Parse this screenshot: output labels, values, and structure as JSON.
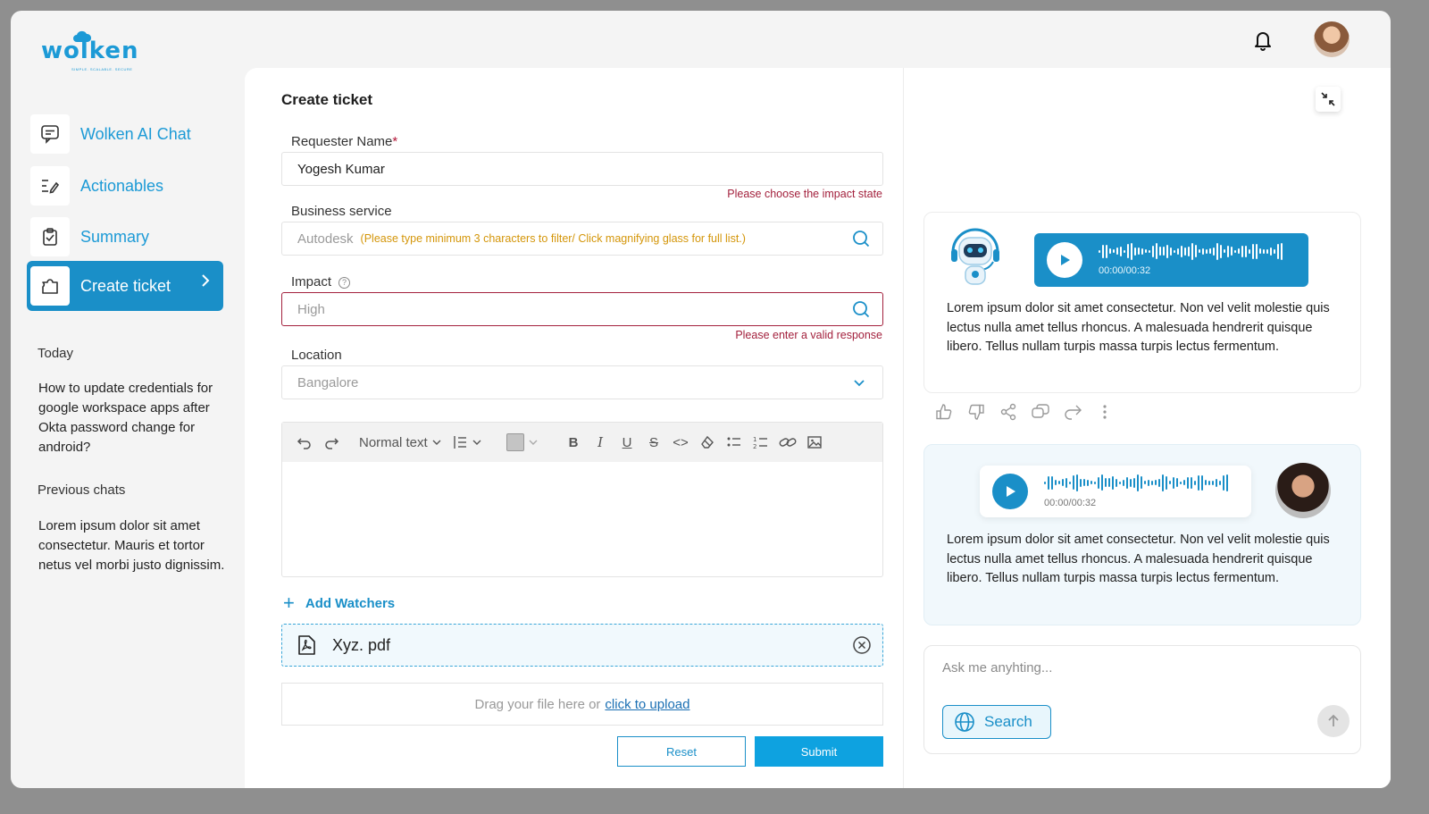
{
  "brand": {
    "name": "wolken",
    "tagline": "SIMPLE. SCALABLE. SECURE"
  },
  "sidebar": {
    "items": [
      {
        "label": "Wolken AI Chat",
        "icon": "chat-bubble-icon"
      },
      {
        "label": "Actionables",
        "icon": "list-edit-icon"
      },
      {
        "label": "Summary",
        "icon": "clipboard-icon"
      },
      {
        "label": "Create ticket",
        "icon": "ticket-icon",
        "active": true
      }
    ],
    "today_heading": "Today",
    "today_chat": "How to update credentials for google workspace apps after Okta password change for android?",
    "previous_heading": "Previous chats",
    "previous_chat": "Lorem ipsum dolor sit amet consectetur. Mauris et tortor netus vel morbi justo dignissim."
  },
  "form": {
    "title": "Create ticket",
    "requester": {
      "label": "Requester Name",
      "required_mark": "*",
      "value": "Yogesh Kumar",
      "error": "Please choose the impact state"
    },
    "business_service": {
      "label": "Business service",
      "placeholder": "Autodesk",
      "hint": "(Please type minimum 3 characters to filter/ Click magnifying glass for full list.)"
    },
    "impact": {
      "label": "Impact",
      "placeholder": "High",
      "error": "Please enter a valid response"
    },
    "location": {
      "label": "Location",
      "placeholder": "Bangalore"
    },
    "editor": {
      "text_style": "Normal text",
      "color": "#c4c4c4"
    },
    "add_watchers": "Add Watchers",
    "attachment": "Xyz. pdf",
    "dropzone": {
      "text": "Drag your file here or",
      "link": "click to upload"
    },
    "reset_label": "Reset",
    "submit_label": "Submit"
  },
  "chat": {
    "bot_message": {
      "audio_time": "00:00/00:32",
      "text": "Lorem ipsum dolor sit amet consectetur. Non vel velit molestie quis lectus nulla amet tellus rhoncus. A malesuada hendrerit quisque libero. Tellus nullam turpis massa turpis lectus fermentum."
    },
    "user_message": {
      "audio_time": "00:00/00:32",
      "text": "Lorem ipsum dolor sit amet consectetur. Non vel velit molestie quis lectus nulla amet tellus rhoncus. A malesuada hendrerit quisque libero. Tellus nullam turpis massa turpis lectus fermentum."
    },
    "input_placeholder": "Ask me anyhting...",
    "search_label": "Search"
  },
  "colors": {
    "accent": "#1a8fc8",
    "error": "#a3213d",
    "hint": "#d4960a",
    "submit": "#0ea2e0"
  }
}
